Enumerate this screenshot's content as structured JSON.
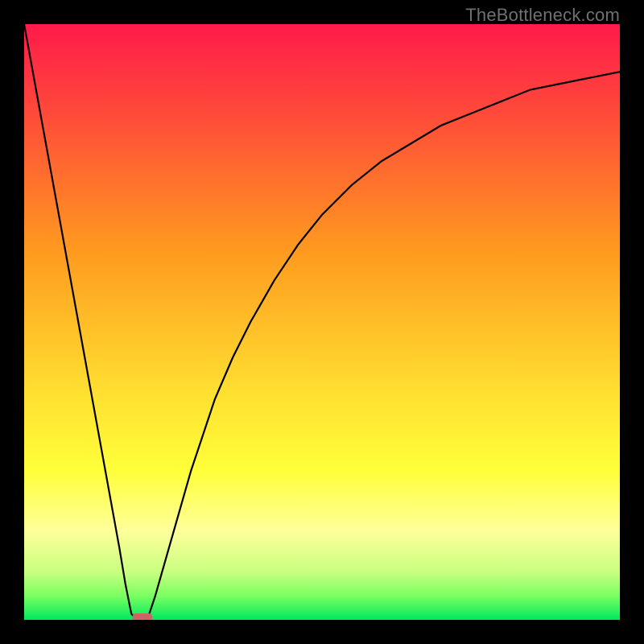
{
  "watermark": "TheBottleneck.com",
  "colors": {
    "black": "#000000",
    "red": "#ff1a4a",
    "orange": "#ff9a1f",
    "yellow": "#ffff3a",
    "paleyellow": "#ffff9a",
    "lightgreen": "#7aff60",
    "green": "#00e860",
    "stroke": "#000000",
    "marker": "#cc6666",
    "watermark": "#707070"
  },
  "chart_data": {
    "type": "line",
    "title": "",
    "xlabel": "",
    "ylabel": "",
    "xlim": [
      0,
      100
    ],
    "ylim": [
      0,
      100
    ],
    "x": [
      0,
      2,
      4,
      6,
      8,
      10,
      12,
      14,
      16,
      17,
      18,
      19,
      20,
      21,
      22,
      24,
      26,
      28,
      30,
      32,
      35,
      38,
      42,
      46,
      50,
      55,
      60,
      65,
      70,
      75,
      80,
      85,
      90,
      95,
      100
    ],
    "values": [
      100,
      89,
      78,
      67,
      56,
      45,
      34,
      23,
      12,
      6,
      1,
      0,
      0,
      1,
      4,
      11,
      18,
      25,
      31,
      37,
      44,
      50,
      57,
      63,
      68,
      73,
      77,
      80,
      83,
      85,
      87,
      89,
      90,
      91,
      92
    ],
    "marker": {
      "x_start": 18.2,
      "x_end": 21.5,
      "y": 0
    },
    "gradient_stops": [
      {
        "pos": 0.0,
        "color": "#ff1a4a"
      },
      {
        "pos": 0.15,
        "color": "#ff4a3a"
      },
      {
        "pos": 0.38,
        "color": "#ff9a1f"
      },
      {
        "pos": 0.62,
        "color": "#ffe030"
      },
      {
        "pos": 0.75,
        "color": "#ffff3a"
      },
      {
        "pos": 0.85,
        "color": "#ffff9a"
      },
      {
        "pos": 0.92,
        "color": "#c8ff80"
      },
      {
        "pos": 0.96,
        "color": "#7aff60"
      },
      {
        "pos": 1.0,
        "color": "#00e860"
      }
    ]
  }
}
